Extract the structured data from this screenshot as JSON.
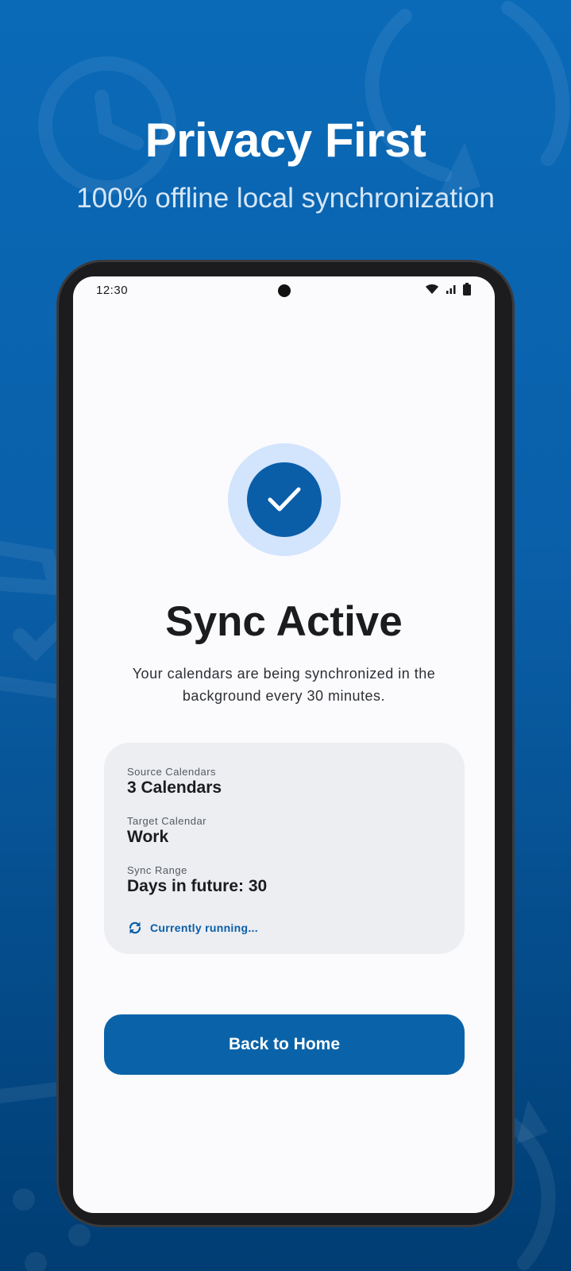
{
  "hero": {
    "title": "Privacy First",
    "subtitle": "100% offline local synchronization"
  },
  "status_bar": {
    "time": "12:30",
    "icons": [
      "wifi-icon",
      "signal-icon",
      "battery-icon"
    ]
  },
  "main": {
    "status_icon": "checkmark-icon",
    "title": "Sync Active",
    "description": "Your calendars are being synchronized in the background every 30 minutes."
  },
  "info": {
    "source_label": "Source Calendars",
    "source_value": "3 Calendars",
    "target_label": "Target Calendar",
    "target_value": "Work",
    "range_label": "Sync Range",
    "range_value": "Days in future: 30",
    "running_text": "Currently running..."
  },
  "actions": {
    "back_label": "Back to Home"
  },
  "colors": {
    "accent": "#0a5ea8",
    "accent_light": "#d3e4fd",
    "card_bg": "#eceef2",
    "background_top": "#0a6ab8",
    "background_bottom": "#003d73"
  }
}
